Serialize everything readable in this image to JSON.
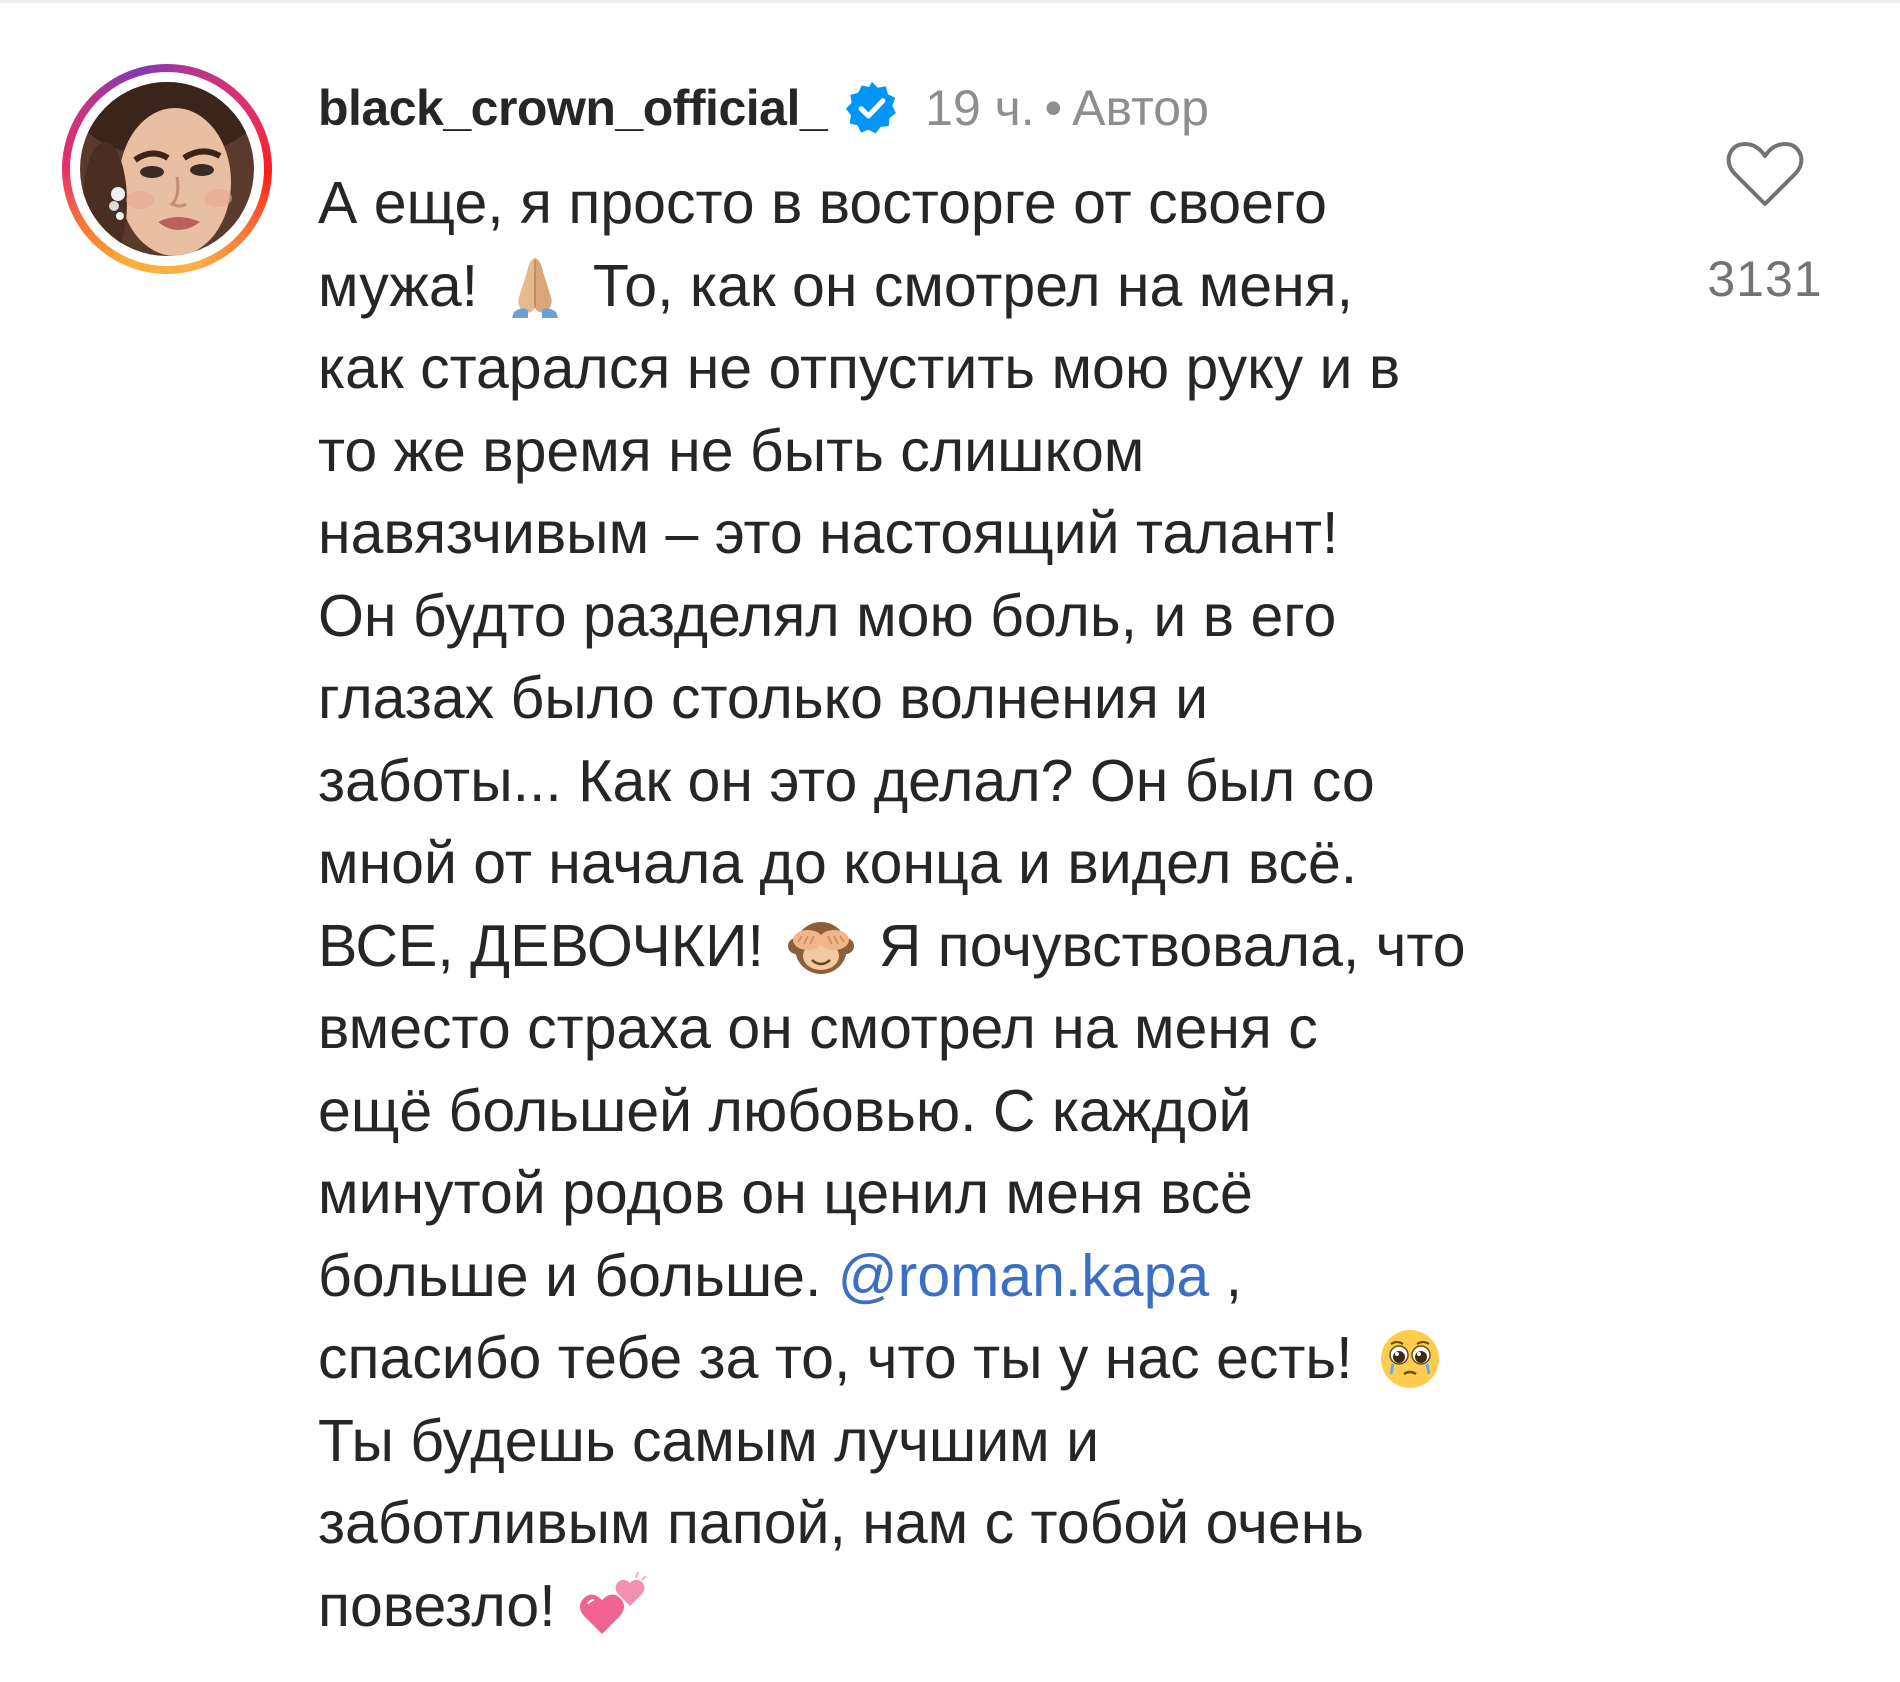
{
  "comment": {
    "username": "black_crown_official_",
    "time": "19 ч.",
    "separator": "•",
    "author_label": "Автор",
    "lines": [
      "А еще, я просто в восторге от своего",
      "мужа!",
      "То, как он смотрел на меня,",
      "как старался не отпустить мою руку и в",
      "то же время не быть слишком",
      "навязчивым – это настоящий талант!",
      "Он будто разделял мою боль, и в его",
      "глазах было столько волнения и",
      "заботы... Как он это делал? Он был со",
      "мной от начала до конца и видел всё.",
      "ВСЕ, ДЕВОЧКИ!",
      "Я почувствовала, что",
      "вместо страха он смотрел на меня с",
      "ещё большей любовью. С каждой",
      "минутой родов он ценил меня всё",
      "больше и больше.",
      "@roman.kapa",
      ",",
      "спасибо тебе за то, что ты у нас есть!",
      "Ты будешь самым лучшим и",
      "заботливым папой, нам с тобой очень",
      "повезло!"
    ],
    "emojis": [
      "praying-hands",
      "see-no-evil-monkey",
      "pleading-face",
      "two-hearts"
    ]
  },
  "likes": {
    "count": "3131"
  },
  "colors": {
    "text": "#262626",
    "meta": "#8e8e8e",
    "mention": "#3b6fc4",
    "verified": "#0095f6"
  }
}
